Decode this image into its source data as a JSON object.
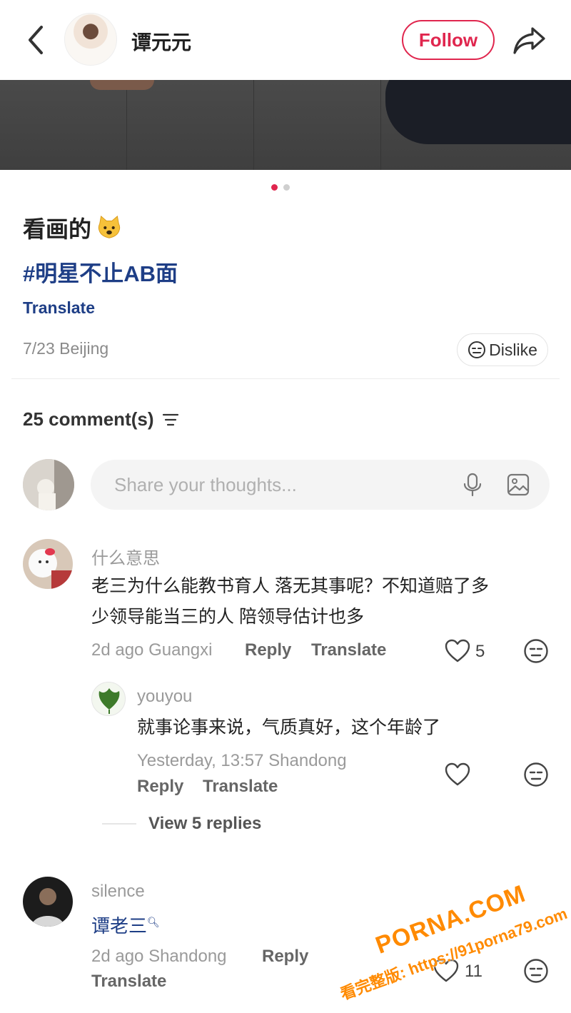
{
  "header": {
    "author_name": "谭元元",
    "follow_label": "Follow"
  },
  "post": {
    "carousel_dots": 2,
    "carousel_active": 0,
    "title": "看画的",
    "title_emoji": "cat-face",
    "hashtag": "#明星不止AB面",
    "translate_label": "Translate",
    "meta": "7/23 Beijing",
    "dislike_label": "Dislike"
  },
  "comments_header": {
    "count_label": "25 comment(s)"
  },
  "composer": {
    "placeholder": "Share your thoughts..."
  },
  "comments": [
    {
      "name": "什么意思",
      "text_line1": "老三为什么能教书育人 落无其事呢？不知道赔了多",
      "text_line2": "少领导能当三的人 陪领导估计也多",
      "meta": "2d ago Guangxi",
      "reply_label": "Reply",
      "translate_label": "Translate",
      "likes": "5",
      "reply": {
        "name": "youyou",
        "text": "就事论事来说，气质真好，这个年龄了",
        "meta": "Yesterday, 13:57 Shandong",
        "reply_label": "Reply",
        "translate_label": "Translate"
      },
      "view_replies": "View 5 replies"
    },
    {
      "name": "silence",
      "text": "谭老三",
      "meta": "2d ago Shandong",
      "reply_label": "Reply",
      "translate_label": "Translate",
      "likes": "11"
    }
  ],
  "watermark": {
    "line1": "PORNA.COM",
    "line2": "看完整版: https://91porna79.com"
  },
  "colors": {
    "accent": "#e0264e",
    "link": "#1e3e86",
    "watermark": "#ff8a00"
  }
}
